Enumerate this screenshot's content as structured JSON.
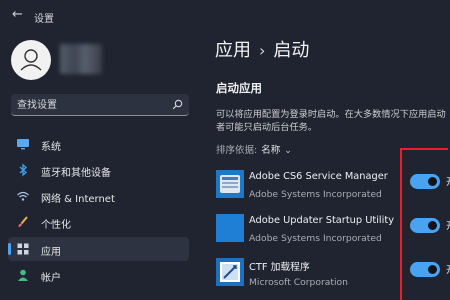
{
  "window": {
    "title": "设置",
    "back_icon": "back-arrow-icon"
  },
  "user": {
    "avatar_icon": "person-icon"
  },
  "search": {
    "placeholder": "查找设置"
  },
  "sidebar": {
    "items": [
      {
        "label": "系统",
        "icon": "monitor-icon"
      },
      {
        "label": "蓝牙和其他设备",
        "icon": "bluetooth-icon"
      },
      {
        "label": "网络 & Internet",
        "icon": "wifi-icon"
      },
      {
        "label": "个性化",
        "icon": "brush-icon"
      },
      {
        "label": "应用",
        "icon": "apps-icon",
        "active": true
      },
      {
        "label": "帐户",
        "icon": "account-icon"
      }
    ]
  },
  "main": {
    "breadcrumb": {
      "parent": "应用",
      "separator": "›",
      "current": "启动"
    },
    "section_title": "启动应用",
    "description_line1": "可以将应用配置为登录时启动。在大多数情况下应用启动",
    "description_line2": "者可能只启动后台任务。",
    "sort": {
      "label": "排序依据:",
      "value": "名称"
    },
    "apps": [
      {
        "name": "Adobe CS6 Service Manager",
        "publisher": "Adobe Systems Incorporated",
        "enabled": true,
        "toggle_label": "开"
      },
      {
        "name": "Adobe Updater Startup Utility",
        "publisher": "Adobe Systems Incorporated",
        "enabled": true,
        "toggle_label": "开"
      },
      {
        "name": "CTF 加载程序",
        "publisher": "Microsoft Corporation",
        "enabled": true,
        "toggle_label": "开"
      }
    ]
  },
  "colors": {
    "accent": "#4aa3f0",
    "background": "#1f2430",
    "highlight": "#e8202a"
  }
}
